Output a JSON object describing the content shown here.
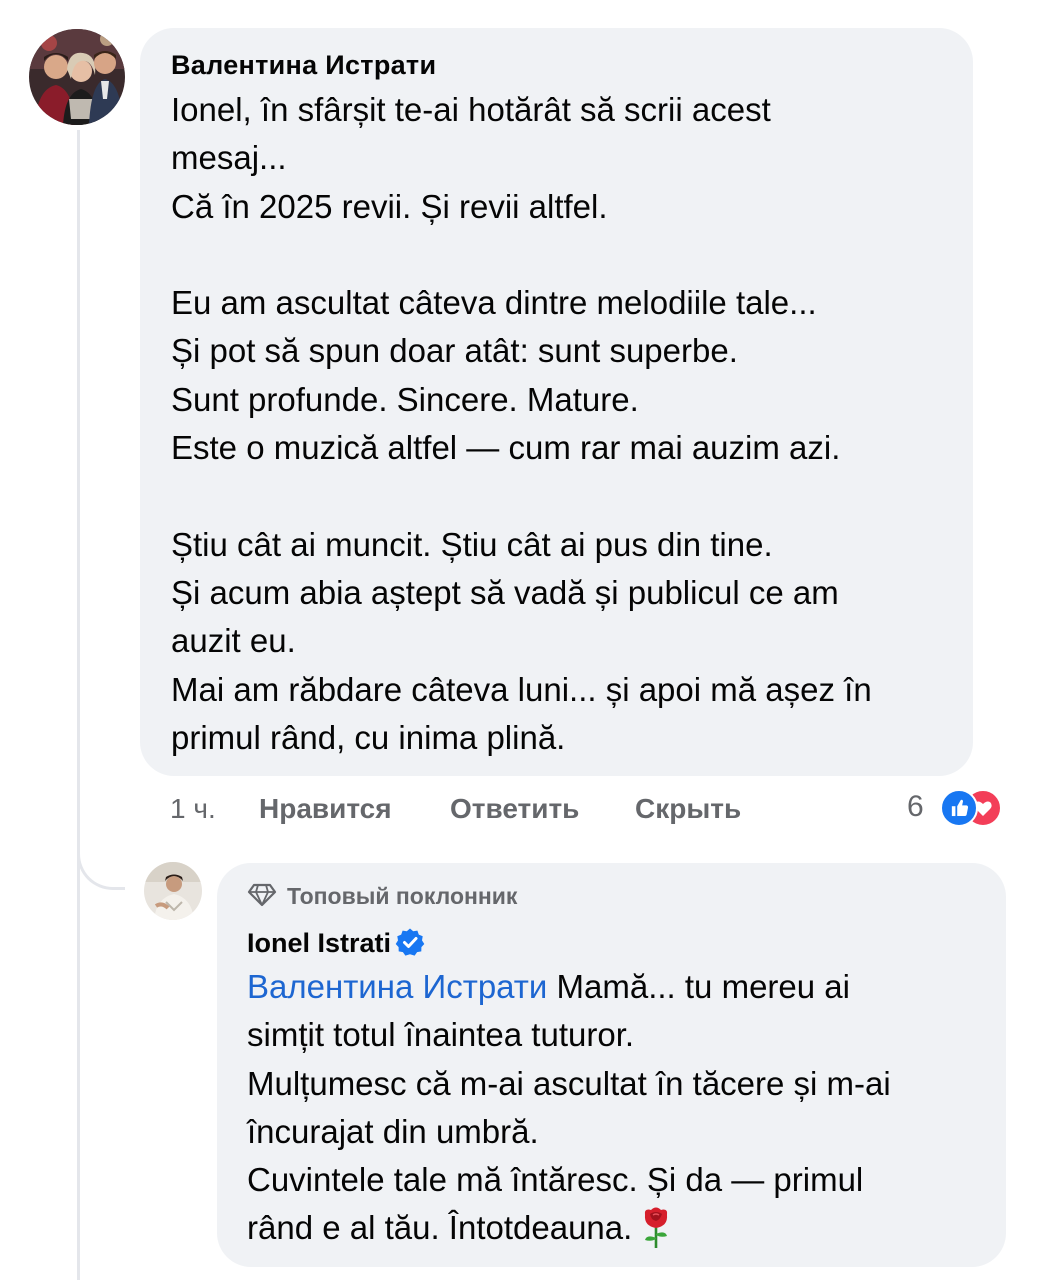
{
  "comment": {
    "author": "Валентина Истрати",
    "avatar_icon": "profile-photo-group",
    "lines": [
      "Ionel, în sfârșit te-ai hotărât să scrii acest",
      "mesaj...",
      "Că în 2025 revii. Și revii altfel.",
      "",
      "Eu am ascultat câteva dintre melodiile tale...",
      "Și pot să spun doar atât: sunt superbe.",
      "Sunt profunde. Sincere. Mature.",
      "Este o muzică altfel — cum rar mai auzim azi.",
      "",
      "Știu cât ai muncit. Știu cât ai pus din tine.",
      "Și acum abia aștept să vadă și publicul ce am",
      "auzit eu.",
      "Mai am răbdare câteva luni... și apoi mă așez în",
      "primul rând, cu inima plină."
    ],
    "time": "1 ч.",
    "actions": {
      "like": "Нравится",
      "reply": "Ответить",
      "hide": "Скрыть"
    },
    "reactions": {
      "count": "6",
      "icons": [
        "like-reaction-icon",
        "love-reaction-icon"
      ]
    }
  },
  "reply": {
    "badge": "Топовый поклонник",
    "badge_icon": "diamond-icon",
    "author": "Ionel Istrati",
    "verified_icon": "verified-badge-icon",
    "mention": "Валентина Истрати",
    "first_line_rest": " Mamă... tu mereu ai",
    "lines": [
      "simțit totul înaintea tuturor.",
      "Mulțumesc că m-ai ascultat în tăcere și m-ai",
      "încurajat din umbră.",
      "Cuvintele tale mă întăresc. Și da — primul"
    ],
    "last_line": "rând e al tău. Întotdeauna.",
    "emoji": "rose-emoji"
  },
  "colors": {
    "bubble": "#f0f2f5",
    "text": "#050505",
    "secondary": "#65676b",
    "mention": "#1d66d1",
    "like_blue": "#1877f2",
    "love_red": "#f33e58",
    "thread_line": "#e4e6eb"
  }
}
